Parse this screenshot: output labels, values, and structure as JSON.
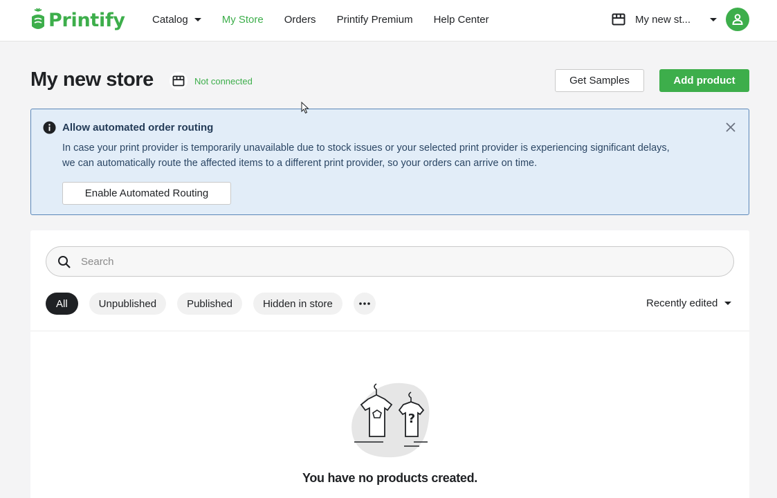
{
  "header": {
    "logo_text": "Printify",
    "nav": [
      {
        "label": "Catalog",
        "dropdown": true,
        "active": false
      },
      {
        "label": "My Store",
        "dropdown": false,
        "active": true
      },
      {
        "label": "Orders",
        "dropdown": false,
        "active": false
      },
      {
        "label": "Printify Premium",
        "dropdown": false,
        "active": false
      },
      {
        "label": "Help Center",
        "dropdown": false,
        "active": false
      }
    ],
    "store_switcher": {
      "label": "My new st...",
      "icon": "storefront-icon"
    },
    "avatar_icon": "user-icon"
  },
  "page": {
    "title": "My new store",
    "status": "Not connected",
    "get_samples_label": "Get Samples",
    "add_product_label": "Add product"
  },
  "banner": {
    "title": "Allow automated order routing",
    "text": "In case your print provider is temporarily unavailable due to stock issues or your selected print provider is experiencing significant delays, we can automatically route the affected items to a different print provider, so your orders can arrive on time.",
    "button_label": "Enable Automated Routing"
  },
  "products": {
    "search_placeholder": "Search",
    "filters": [
      {
        "label": "All",
        "active": true
      },
      {
        "label": "Unpublished",
        "active": false
      },
      {
        "label": "Published",
        "active": false
      },
      {
        "label": "Hidden in store",
        "active": false
      }
    ],
    "sort_label": "Recently edited",
    "empty_message": "You have no products created."
  },
  "colors": {
    "brand_green": "#3dae4b",
    "banner_bg": "#e2edf8",
    "banner_border": "#5a86b8",
    "text_dark": "#1f2124"
  }
}
